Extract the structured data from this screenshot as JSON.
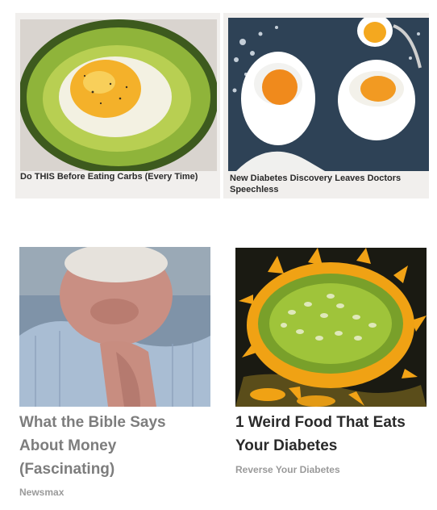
{
  "ads": [
    {
      "title": "Do THIS Before Eating Carbs (Every Time)",
      "image": "avocado-egg-image"
    },
    {
      "title": "New Diabetes Discovery Leaves Doctors Speechless",
      "image": "soft-boiled-eggs-image"
    },
    {
      "title": "What the Bible Says About Money (Fascinating)",
      "source": "Newsmax",
      "image": "praying-man-image"
    },
    {
      "title": "1 Weird Food That Eats Your Diabetes",
      "source": "Reverse Your Diabetes",
      "image": "horned-melon-image"
    }
  ],
  "colors": {
    "title_dark": "#2a2a2a",
    "title_gray": "#7d7d7d",
    "source_gray": "#9a9a9a",
    "card_bg": "#f1efed"
  }
}
